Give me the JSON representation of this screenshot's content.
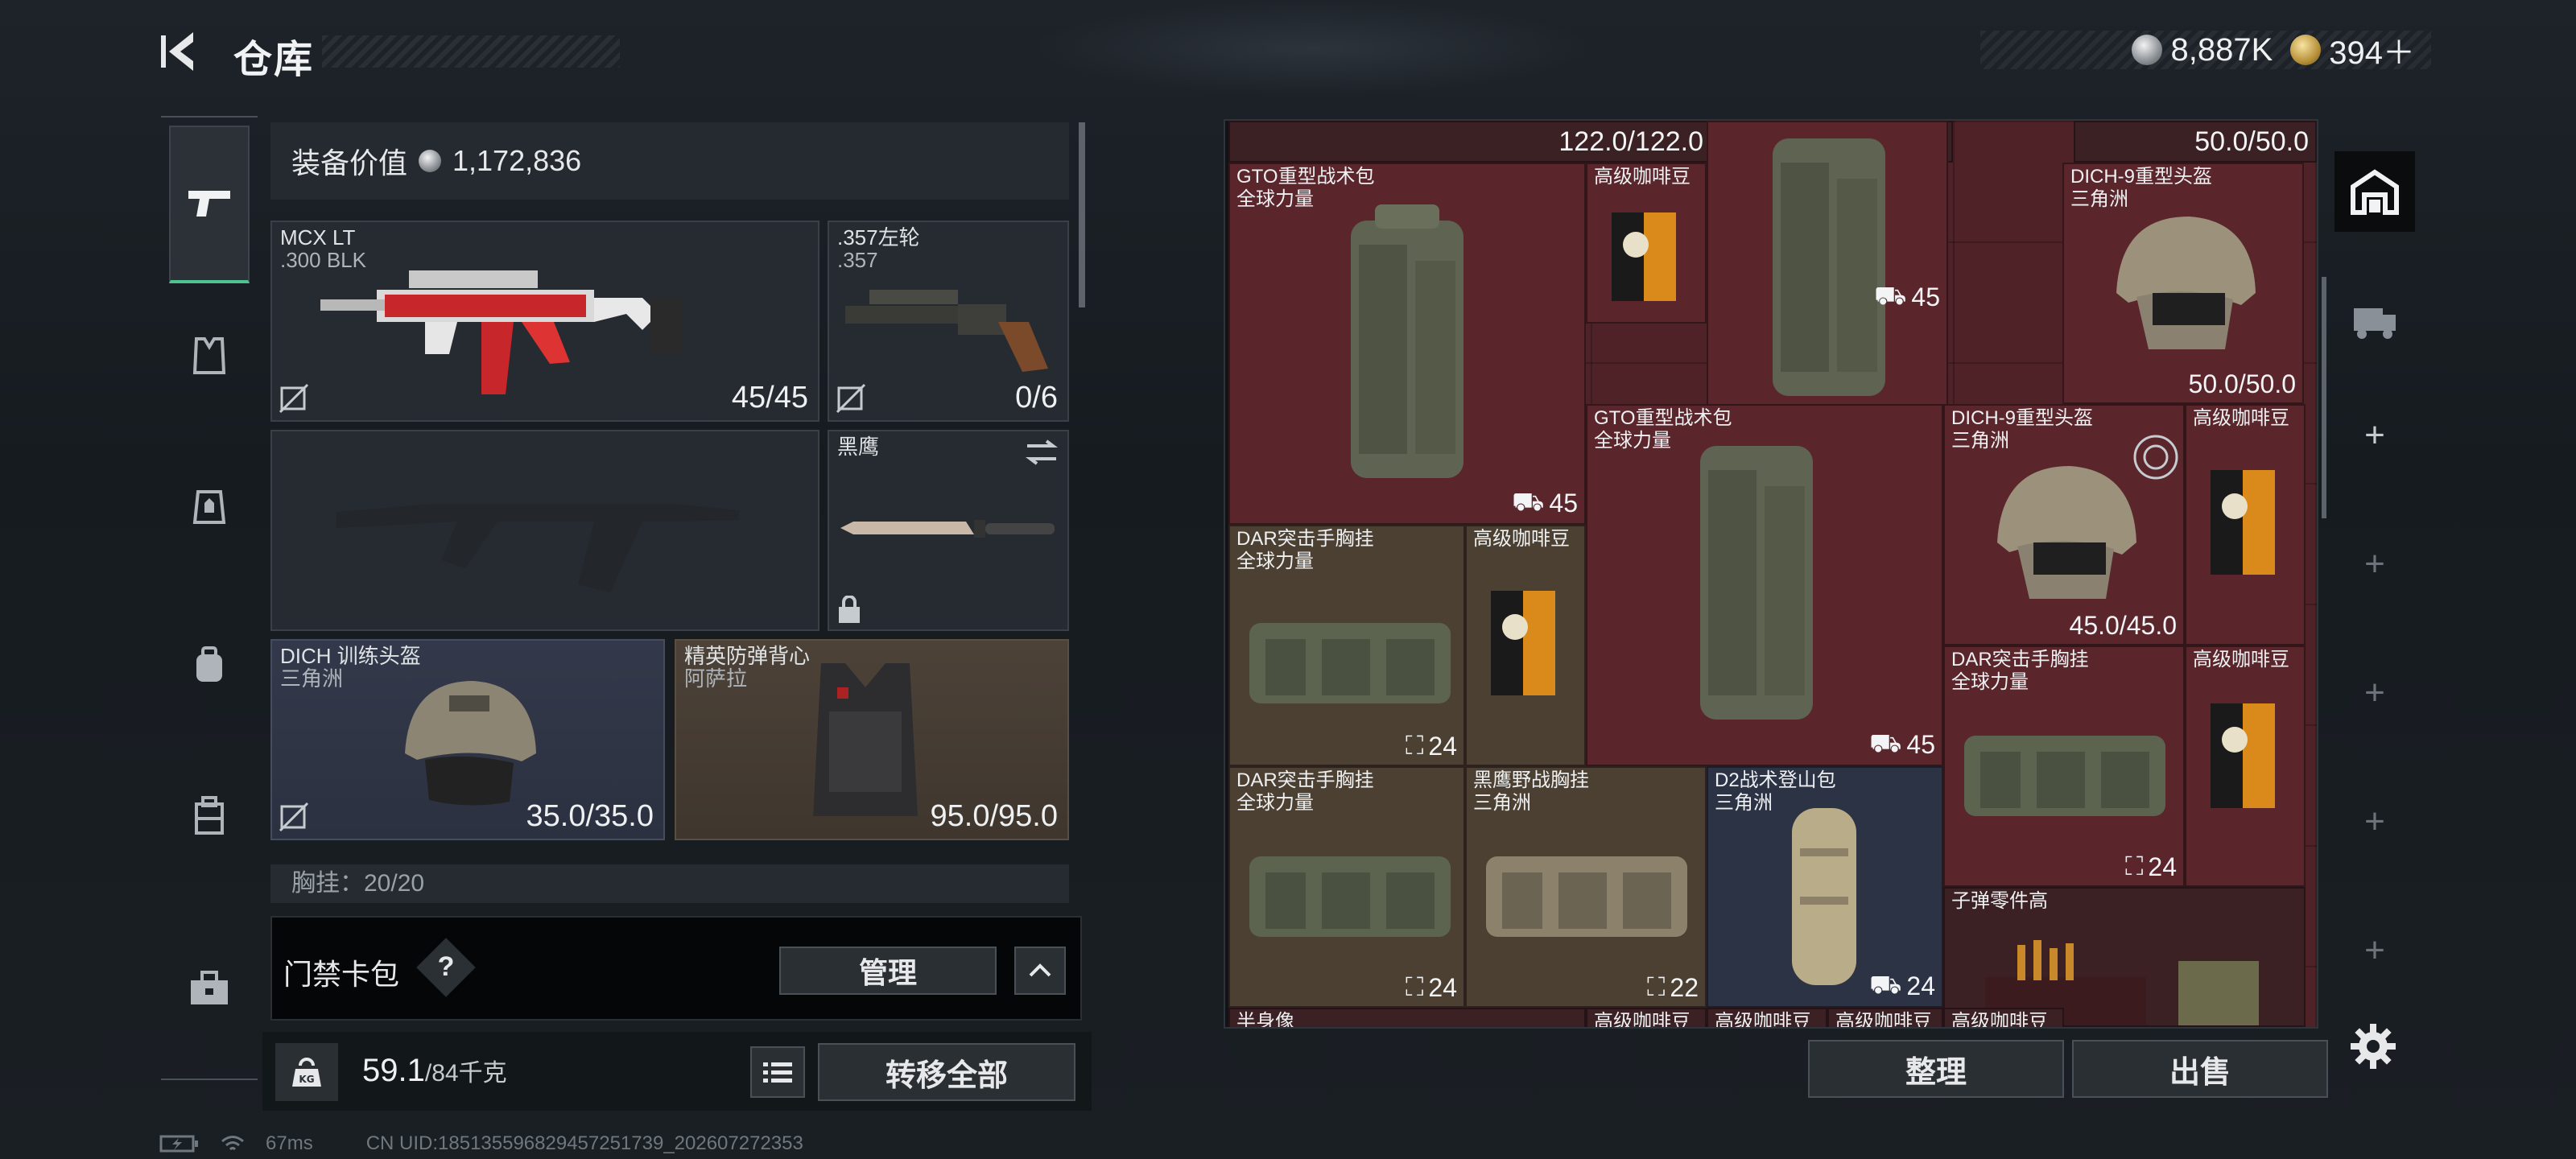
{
  "header": {
    "title": "仓库"
  },
  "currency": {
    "silver": "8,887K",
    "gold": "394＋"
  },
  "equipment": {
    "value_label": "装备价值",
    "value": "1,172,836",
    "primary_weapon": {
      "name": "MCX LT",
      "sub": ".300 BLK",
      "value": "45/45"
    },
    "sidearm": {
      "name": ".357左轮",
      "sub": ".357",
      "value": "0/6"
    },
    "melee": {
      "name": "黑鹰"
    },
    "helmet": {
      "name": "DICH 训练头盔",
      "sub": "三角洲",
      "value": "35.0/35.0"
    },
    "armor": {
      "name": "精英防弹背心",
      "sub": "阿萨拉",
      "value": "95.0/95.0"
    },
    "chest_rig_peek": "胸挂：20/20"
  },
  "keycard": {
    "label": "门禁卡包",
    "help": "?",
    "manage": "管理"
  },
  "footer": {
    "weight": "59.1",
    "capacity": "/84千克",
    "transfer_all": "转移全部"
  },
  "stash": {
    "top_values": [
      "122.0/122.0",
      "50.0/50.0"
    ],
    "items": [
      {
        "name": "GTO重型战术包",
        "sub": "全球力量",
        "value": "45"
      },
      {
        "name": "高级咖啡豆",
        "sub": "",
        "value": ""
      },
      {
        "name": "",
        "sub": "",
        "value": "45"
      },
      {
        "name": "DICH-9重型头盔",
        "sub": "三角洲",
        "value": "50.0/50.0"
      },
      {
        "name": "GTO重型战术包",
        "sub": "全球力量",
        "value": "45"
      },
      {
        "name": "DICH-9重型头盔",
        "sub": "三角洲",
        "value": "45.0/45.0"
      },
      {
        "name": "高级咖啡豆",
        "sub": "",
        "value": ""
      },
      {
        "name": "DAR突击手胸挂",
        "sub": "全球力量",
        "value": "24"
      },
      {
        "name": "高级咖啡豆",
        "sub": "",
        "value": ""
      },
      {
        "name": "DAR突击手胸挂",
        "sub": "全球力量",
        "value": "24"
      },
      {
        "name": "高级咖啡豆",
        "sub": "",
        "value": ""
      },
      {
        "name": "DAR突击手胸挂",
        "sub": "全球力量",
        "value": "24"
      },
      {
        "name": "黑鹰野战胸挂",
        "sub": "三角洲",
        "value": "22"
      },
      {
        "name": "D2战术登山包",
        "sub": "三角洲",
        "value": "24"
      },
      {
        "name": "子弹零件高",
        "sub": "",
        "value": ""
      }
    ],
    "bottom_peek": [
      "半身像",
      "高级咖啡豆",
      "高级咖啡豆",
      "高级咖啡豆",
      "高级咖啡豆"
    ]
  },
  "actions": {
    "tidy": "整理",
    "sell": "出售"
  },
  "status": {
    "ping": "67ms",
    "uid": "CN UID:18513559682945725173​9_202607272353"
  },
  "colors": {
    "accent_green": "#4ec38f",
    "stash_red": "#5a262c",
    "stash_brown": "#4c4032",
    "stash_blue": "#2c3345"
  }
}
